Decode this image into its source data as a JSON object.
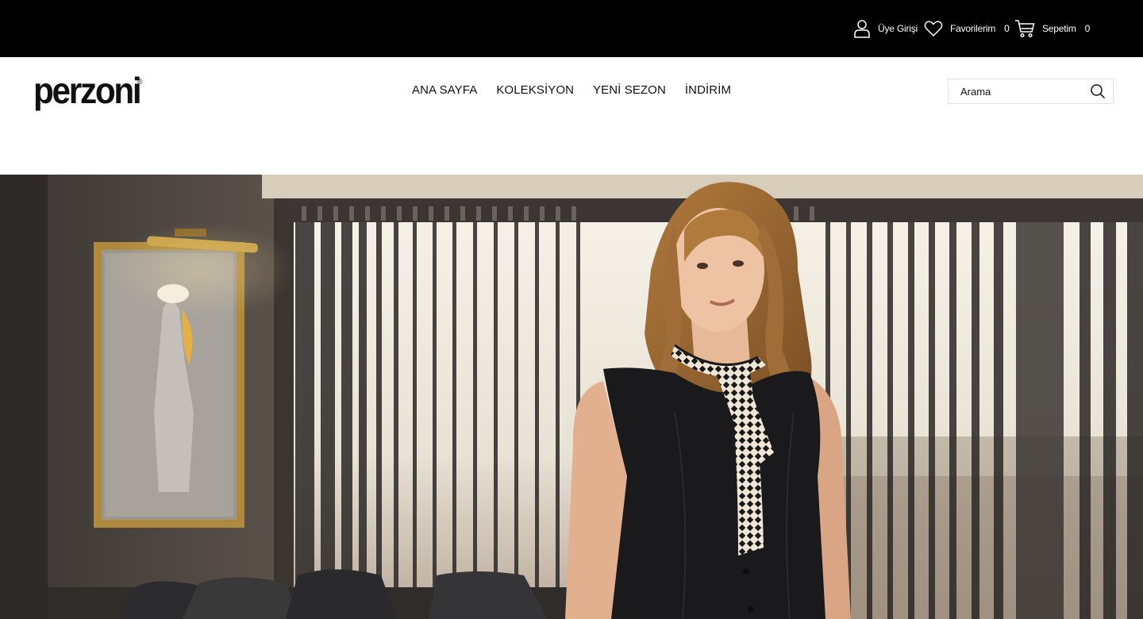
{
  "topbar": {
    "login": {
      "label": "Üye Girişi",
      "icon": "user-icon"
    },
    "favorites": {
      "label": "Favorilerim",
      "count": "0",
      "icon": "heart-icon"
    },
    "cart": {
      "label": "Sepetim",
      "count": "0",
      "icon": "cart-icon"
    }
  },
  "header": {
    "logo": "perzoni",
    "logo_mark": "®",
    "nav": [
      "ANA SAYFA",
      "KOLEKSİYON",
      "YENİ SEZON",
      "İNDİRİM"
    ],
    "search": {
      "placeholder": "Arama",
      "icon": "search-icon"
    }
  },
  "colors": {
    "topbar_bg": "#000000",
    "page_bg": "#ffffff",
    "text": "#111111"
  },
  "hero": {
    "image": "woman in black sleeveless vest with polka-dot neck scarf in office interior"
  }
}
